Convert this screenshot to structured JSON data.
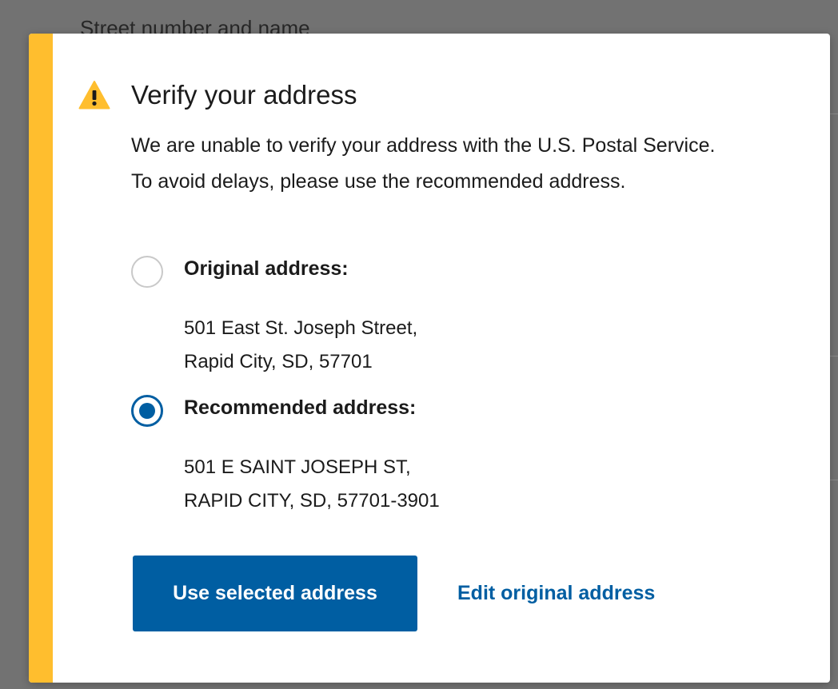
{
  "background": {
    "partial_label": "Street number and name"
  },
  "modal": {
    "title": "Verify your address",
    "message": "We are unable to verify your address with the U.S. Postal Service. To avoid delays, please use the recommended address.",
    "accent_color": "#ffbe2e",
    "icon": "warning-icon",
    "options": [
      {
        "label": "Original address:",
        "line1": "501 East St. Joseph Street,",
        "line2": "Rapid City, SD, 57701",
        "selected": false
      },
      {
        "label": "Recommended address:",
        "line1": "501 E SAINT JOSEPH ST,",
        "line2": "RAPID CITY, SD, 57701-3901",
        "selected": true
      }
    ],
    "primary_button": "Use selected address",
    "secondary_link": "Edit original address",
    "primary_color": "#005ea2"
  }
}
